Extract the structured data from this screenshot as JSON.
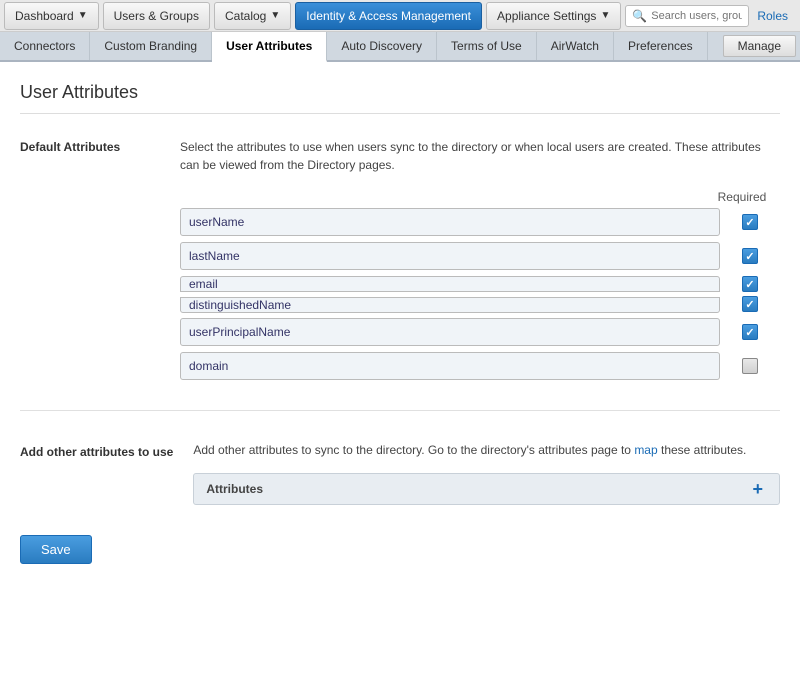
{
  "topNav": {
    "dashboard_label": "Dashboard",
    "users_groups_label": "Users & Groups",
    "catalog_label": "Catalog",
    "identity_label": "Identity & Access Management",
    "appliance_label": "Appliance Settings",
    "search_placeholder": "Search users, groups or applications",
    "roles_label": "Roles"
  },
  "subNav": {
    "connectors_label": "Connectors",
    "custom_branding_label": "Custom Branding",
    "user_attributes_label": "User Attributes",
    "auto_discovery_label": "Auto Discovery",
    "terms_label": "Terms of Use",
    "airwatch_label": "AirWatch",
    "preferences_label": "Preferences",
    "manage_label": "Manage"
  },
  "page": {
    "title": "User Attributes",
    "default_attrs_label": "Default Attributes",
    "default_attrs_desc": "Select the attributes to use when users sync to the directory or when local users are created. These attributes can be viewed from the Directory pages.",
    "required_label": "Required",
    "attributes": [
      {
        "name": "userName",
        "checked": true
      },
      {
        "name": "lastName",
        "checked": true
      },
      {
        "name": "email",
        "checked": true
      },
      {
        "name": "distinguishedName",
        "checked": true
      },
      {
        "name": "userPrincipalName",
        "checked": true
      },
      {
        "name": "domain",
        "checked": false
      }
    ],
    "add_label": "Add other attributes to use",
    "add_desc_part1": "Add other attributes to sync to the directory. Go to the directory's attributes page to ",
    "add_desc_map": "map",
    "add_desc_part2": " these attributes.",
    "attrs_col_label": "Attributes",
    "add_icon": "+",
    "save_label": "Save"
  }
}
